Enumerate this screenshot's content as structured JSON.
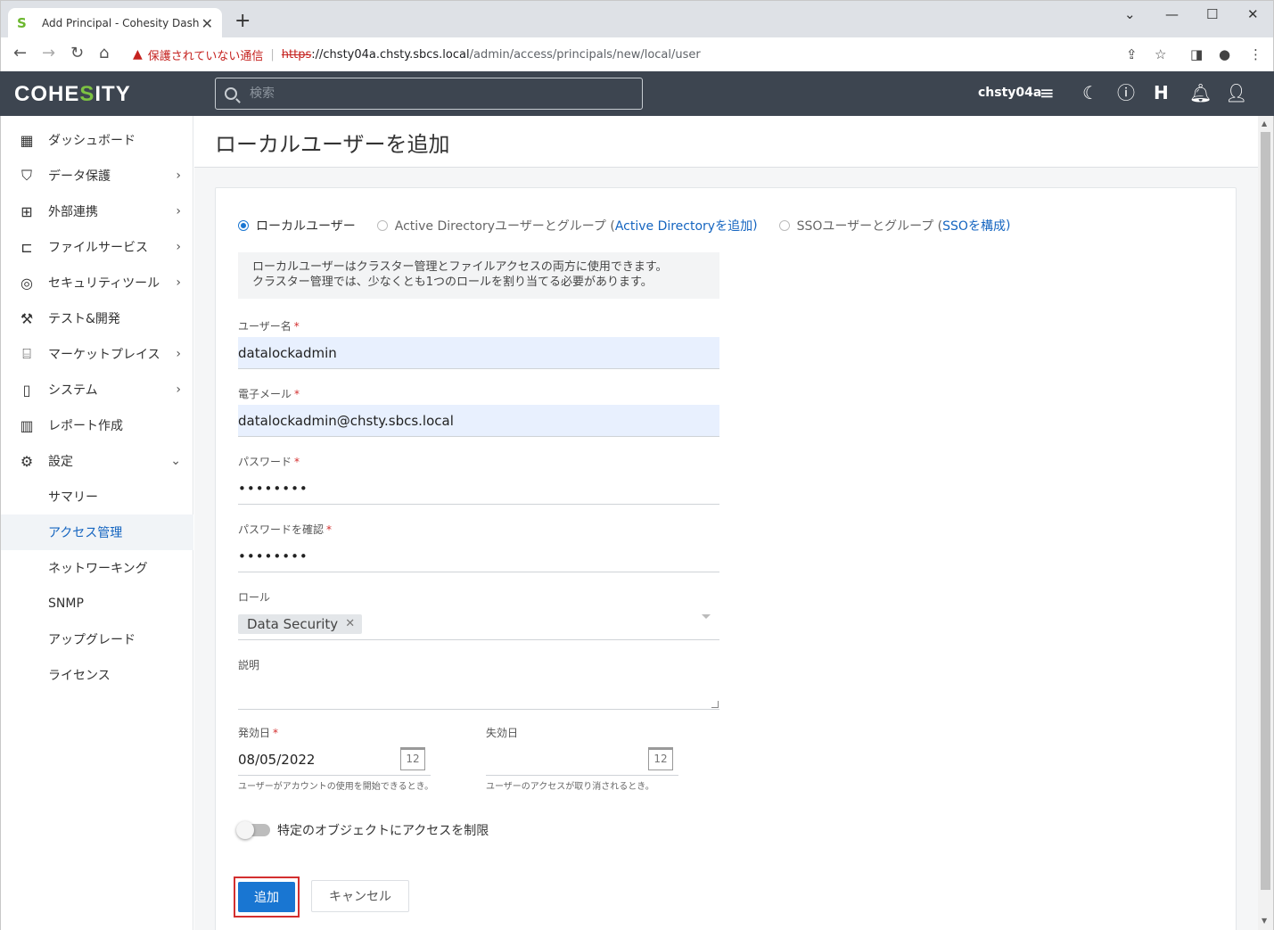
{
  "browser": {
    "tab_title": "Add Principal - Cohesity Dashboard",
    "tab_close": "✕",
    "new_tab": "+",
    "security_warning": "保護されていない通信",
    "url_scheme": "https",
    "url_host": "://chsty04a.chsty.sbcs.local",
    "url_path": "/admin/access/principals/new/local/user"
  },
  "header": {
    "logo_pre": "COHE",
    "logo_accent": "S",
    "logo_post": "ITY",
    "search_placeholder": "検索",
    "cluster_name": "chsty04a",
    "accent_color": "#7dc242"
  },
  "sidebar": {
    "items": [
      {
        "label": "ダッシュボード",
        "icon": "dashboard-icon"
      },
      {
        "label": "データ保護",
        "icon": "shield-icon"
      },
      {
        "label": "外部連携",
        "icon": "hierarchy-icon"
      },
      {
        "label": "ファイルサービス",
        "icon": "folder-icon"
      },
      {
        "label": "セキュリティツール",
        "icon": "fingerprint-icon"
      },
      {
        "label": "テスト&開発",
        "icon": "wrench-icon"
      },
      {
        "label": "マーケットプレイス",
        "icon": "store-icon"
      },
      {
        "label": "システム",
        "icon": "system-icon"
      },
      {
        "label": "レポート作成",
        "icon": "report-icon"
      },
      {
        "label": "設定",
        "icon": "gear-icon"
      }
    ],
    "settings_sub": [
      "サマリー",
      "アクセス管理",
      "ネットワーキング",
      "SNMP",
      "アップグレード",
      "ライセンス"
    ]
  },
  "page": {
    "title": "ローカルユーザーを追加",
    "radio_local": "ローカルユーザー",
    "radio_ad": "Active Directoryユーザーとグループ (",
    "radio_ad_link": "Active Directoryを追加",
    "radio_sso": "SSOユーザーとグループ (",
    "radio_sso_link": "SSOを構成",
    "radio_close": ")",
    "info_line1": "ローカルユーザーはクラスター管理とファイルアクセスの両方に使用できます。",
    "info_line2": "クラスター管理では、少なくとも1つのロールを割り当てる必要があります。",
    "username_label": "ユーザー名",
    "username_value": "datalockadmin",
    "email_label": "電子メール",
    "email_value": "datalockadmin@chsty.sbcs.local",
    "password_label": "パスワード",
    "password_value": "••••••••",
    "password_confirm_label": "パスワードを確認",
    "password_confirm_value": "••••••••",
    "role_label": "ロール",
    "role_chip": "Data Security",
    "role_chip_remove": "✕",
    "description_label": "説明",
    "start_date_label": "発効日",
    "start_date_value": "08/05/2022",
    "start_date_hint": "ユーザーがアカウントの使用を開始できるとき。",
    "end_date_label": "失効日",
    "end_date_hint": "ユーザーのアクセスが取り消されるとき。",
    "calendar_day": "12",
    "required_mark": "*",
    "restrict_toggle_label": "特定のオブジェクトにアクセスを制限",
    "add_button": "追加",
    "cancel_button": "キャンセル"
  }
}
